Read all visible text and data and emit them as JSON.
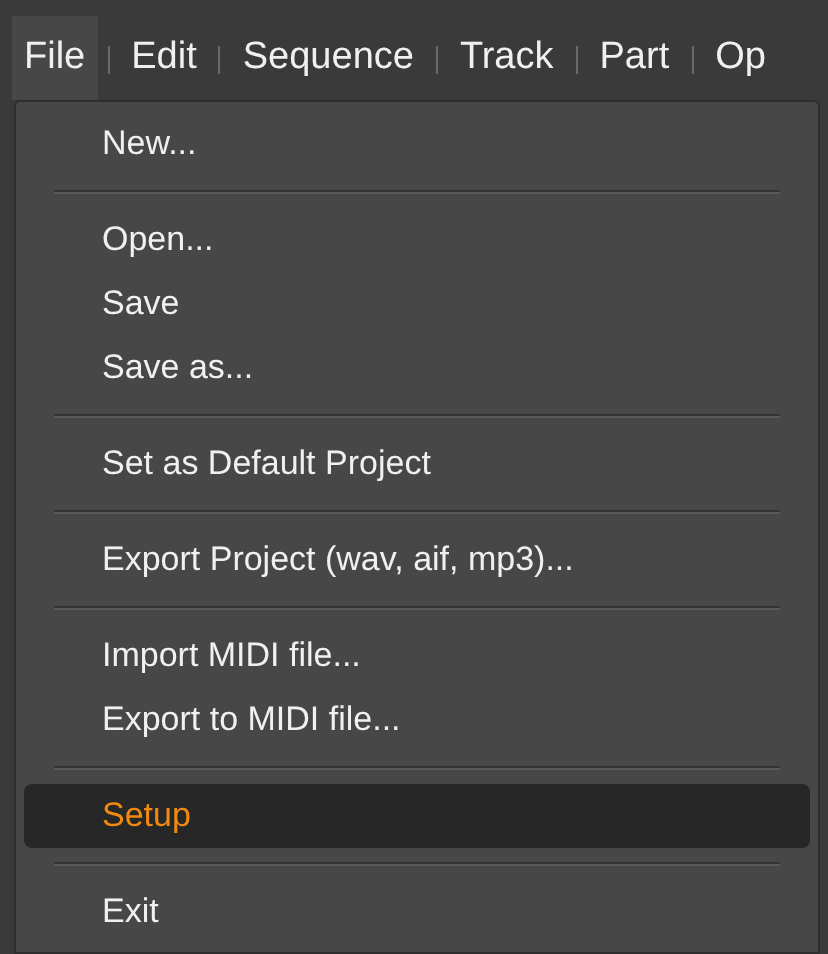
{
  "menubar": [
    {
      "label": "File",
      "selected": true
    },
    {
      "label": "Edit",
      "selected": false
    },
    {
      "label": "Sequence",
      "selected": false
    },
    {
      "label": "Track",
      "selected": false
    },
    {
      "label": "Part",
      "selected": false
    },
    {
      "label": "Op",
      "selected": false
    }
  ],
  "menu": {
    "groups": [
      [
        {
          "label": "New...",
          "selected": false
        }
      ],
      [
        {
          "label": "Open...",
          "selected": false
        },
        {
          "label": "Save",
          "selected": false
        },
        {
          "label": "Save as...",
          "selected": false
        }
      ],
      [
        {
          "label": "Set as Default Project",
          "selected": false
        }
      ],
      [
        {
          "label": "Export Project (wav, aif, mp3)...",
          "selected": false
        }
      ],
      [
        {
          "label": "Import MIDI file...",
          "selected": false
        },
        {
          "label": "Export to MIDI file...",
          "selected": false
        }
      ],
      [
        {
          "label": "Setup",
          "selected": true
        }
      ],
      [
        {
          "label": "Exit",
          "selected": false
        }
      ]
    ]
  }
}
